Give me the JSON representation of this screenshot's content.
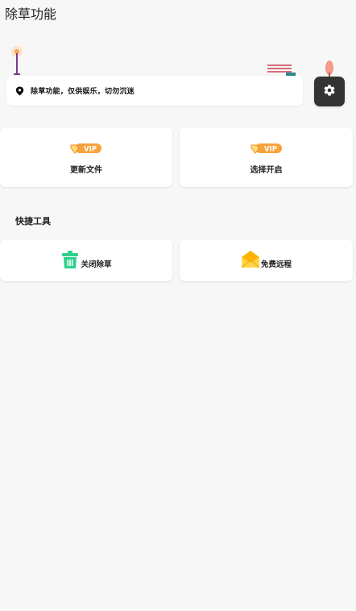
{
  "header": {
    "title": "除草功能"
  },
  "notice": {
    "text": "除草功能，仅供娱乐，切勿沉迷"
  },
  "vip_cards": [
    {
      "badge": "VIP",
      "label": "更新文件"
    },
    {
      "badge": "VIP",
      "label": "选择开启"
    }
  ],
  "section": {
    "title": "快捷工具"
  },
  "tools": [
    {
      "label": "关闭除草",
      "icon": "trash-bin-icon"
    },
    {
      "label": "免费远程",
      "icon": "envelope-icon"
    }
  ],
  "colors": {
    "vip_orange": "#f28c1e",
    "trash_green": "#2fd08a",
    "envelope_yellow": "#ffc21a",
    "settings_bg": "#333333"
  }
}
